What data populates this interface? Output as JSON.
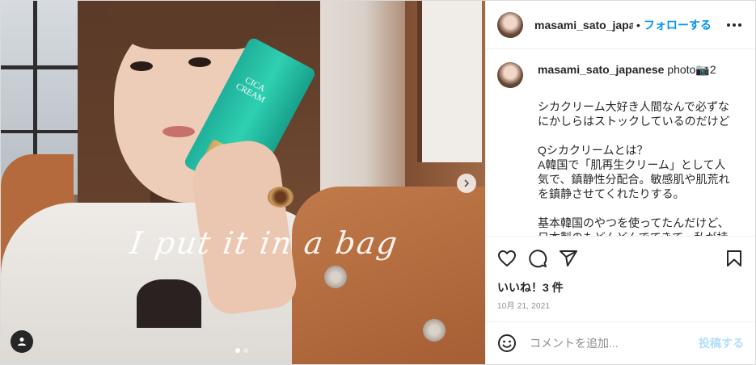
{
  "header": {
    "username": "masami_sato_japanese",
    "separator": "•",
    "follow_label": "フォローする"
  },
  "caption": {
    "username": "masami_sato_japanese",
    "prefix": "photo",
    "camera_emoji": "📷",
    "count": "2",
    "text": "シカクリーム大好き人間なんで必ずな\nにかしらはストックしているのだけど\n\nQシカクリームとは？\nA韓国で「肌再生クリーム」として人\n気で、鎮静性分配合。敏感肌や肌荒れ\nを鎮静させてくれたりする。\n\n基本韓国のやつを使ってたんだけど、\n日本製のもどんどんでてきて、私が持"
  },
  "media": {
    "overlay_text": "I put it in a bag",
    "tube_label": "CICA\nCREAM"
  },
  "actions": {
    "icons": [
      "heart-icon",
      "comment-icon",
      "share-icon",
      "bookmark-icon"
    ]
  },
  "likes": "いいね！3 件",
  "date": "10月 21, 2021",
  "comment_box": {
    "placeholder": "コメントを追加...",
    "post_label": "投稿する"
  },
  "colors": {
    "accent": "#0095f6",
    "post_disabled": "#b2dffc",
    "muted": "#8e8e8e",
    "tube": "#2fd0b2"
  }
}
